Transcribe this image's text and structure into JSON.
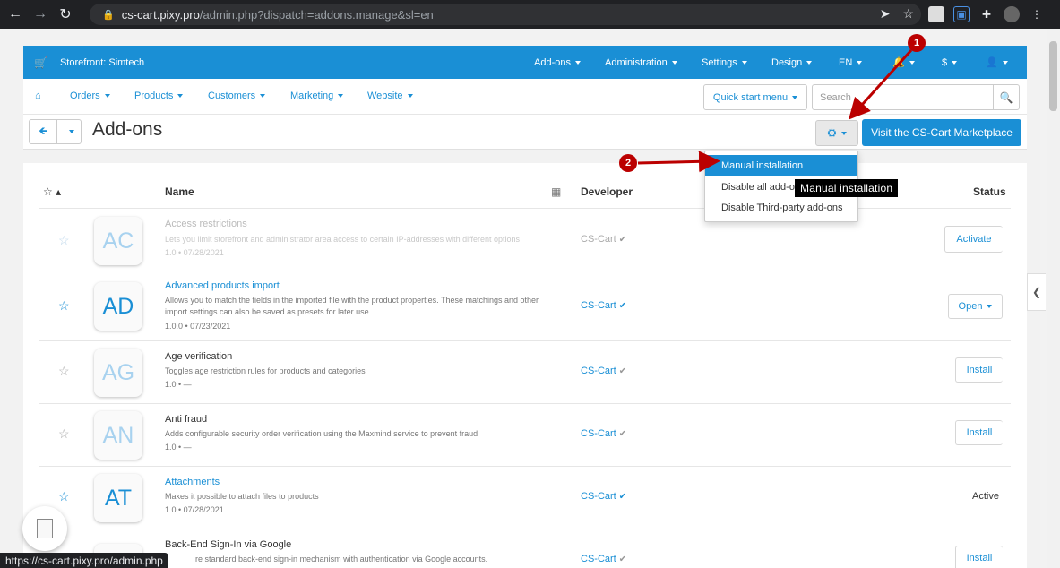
{
  "browser": {
    "url_host": "cs-cart.pixy.pro",
    "url_path": "/admin.php?dispatch=addons.manage&sl=en",
    "status_url": "https://cs-cart.pixy.pro/admin.php"
  },
  "topbar": {
    "store": "Storefront: Simtech",
    "menus": [
      "Add-ons",
      "Administration",
      "Settings",
      "Design",
      "EN",
      "$"
    ]
  },
  "navbar": {
    "items": [
      "Orders",
      "Products",
      "Customers",
      "Marketing",
      "Website"
    ],
    "quick_start": "Quick start menu",
    "search_placeholder": "Search"
  },
  "titlebar": {
    "title": "Add-ons",
    "marketplace_button": "Visit the CS-Cart Marketplace"
  },
  "dropdown": {
    "items": [
      "Manual installation",
      "Disable all add-o",
      "Disable Third-party add-ons"
    ],
    "tooltip": "Manual installation"
  },
  "table": {
    "headers": {
      "name": "Name",
      "developer": "Developer",
      "status": "Status"
    },
    "rows": [
      {
        "code": "AC",
        "name": "Access restrictions",
        "desc": "Lets you limit storefront and administrator area access to certain IP-addresses with different options",
        "version": "1.0 • 07/28/2021",
        "developer": "CS-Cart",
        "status": "Activate"
      },
      {
        "code": "AD",
        "name": "Advanced products import",
        "desc": "Allows you to match the fields in the imported file with the product properties. These matchings and other import settings can also be saved as presets for later use",
        "version": "1.0.0 • 07/23/2021",
        "developer": "CS-Cart",
        "status": "Open"
      },
      {
        "code": "AG",
        "name": "Age verification",
        "desc": "Toggles age restriction rules for products and categories",
        "version": "1.0 • —",
        "developer": "CS-Cart",
        "status": "Install"
      },
      {
        "code": "AN",
        "name": "Anti fraud",
        "desc": "Adds configurable security order verification using the Maxmind service to prevent fraud",
        "version": "1.0 • —",
        "developer": "CS-Cart",
        "status": "Install"
      },
      {
        "code": "AT",
        "name": "Attachments",
        "desc": "Makes it possible to attach files to products",
        "version": "1.0 • 07/28/2021",
        "developer": "CS-Cart",
        "status": "Active"
      },
      {
        "code": "BA",
        "name": "Back-End Sign-In via Google",
        "desc": "re standard back-end sign-in mechanism with authentication via Google accounts.",
        "version": "",
        "developer": "CS-Cart",
        "status": "Install"
      }
    ]
  },
  "markers": [
    "1",
    "2"
  ],
  "colors": {
    "primary": "#1a8fd5",
    "annotation": "#b00000"
  }
}
